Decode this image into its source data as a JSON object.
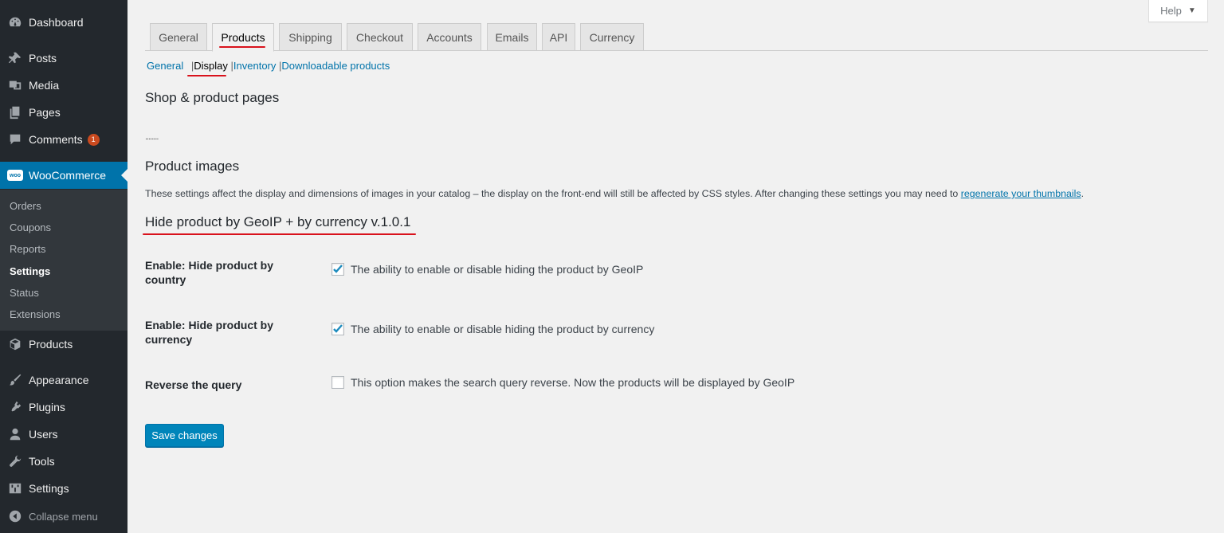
{
  "sidebar": {
    "dashboard": {
      "label": "Dashboard",
      "icon": "dashboard-icon"
    },
    "posts": {
      "label": "Posts",
      "icon": "pin-icon"
    },
    "media": {
      "label": "Media",
      "icon": "media-icon"
    },
    "pages": {
      "label": "Pages",
      "icon": "pages-icon"
    },
    "comments": {
      "label": "Comments",
      "icon": "comment-icon",
      "badge": "1"
    },
    "woocommerce": {
      "label": "WooCommerce",
      "icon": "woo-icon",
      "logo_text": "woo"
    },
    "submenu": {
      "orders": "Orders",
      "coupons": "Coupons",
      "reports": "Reports",
      "settings": "Settings",
      "status": "Status",
      "extensions": "Extensions"
    },
    "products": {
      "label": "Products",
      "icon": "box-icon"
    },
    "appearance": {
      "label": "Appearance",
      "icon": "brush-icon"
    },
    "plugins": {
      "label": "Plugins",
      "icon": "plug-icon"
    },
    "users": {
      "label": "Users",
      "icon": "user-icon"
    },
    "tools": {
      "label": "Tools",
      "icon": "wrench-icon"
    },
    "settings": {
      "label": "Settings",
      "icon": "sliders-icon"
    },
    "collapse": {
      "label": "Collapse menu",
      "icon": "collapse-icon"
    }
  },
  "help": {
    "label": "Help",
    "caret": "▼"
  },
  "tabs": [
    "General",
    "Products",
    "Shipping",
    "Checkout",
    "Accounts",
    "Emails",
    "API",
    "Currency"
  ],
  "subnav": {
    "general": "General",
    "sep1": "|",
    "display": "Display",
    "sep2": "|",
    "inventory": "Inventory",
    "sep3": "|",
    "downloadable": "Downloadable products"
  },
  "sections": {
    "shop_title": "Shop & product pages",
    "dots": "........",
    "images_title": "Product images",
    "images_desc": "These settings affect the display and dimensions of images in your catalog – the display on the front-end will still be affected by CSS styles. After changing these settings you may need to",
    "regenerate_link": "regenerate your thumbnails",
    "desc_end": ".",
    "plugin_title": "Hide product by GeoIP + by currency v.1.0.1"
  },
  "fields": {
    "country": {
      "label": "Enable: Hide product by country",
      "text": "The ability to enable or disable hiding the product by GeoIP",
      "checked": true
    },
    "currency": {
      "label": "Enable: Hide product by currency",
      "text": "The ability to enable or disable hiding the product by currency",
      "checked": true
    },
    "reverse": {
      "label": "Reverse the query",
      "text": "This option makes the search query reverse. Now the products will be displayed by GeoIP",
      "checked": false
    }
  },
  "save_button": "Save changes",
  "colors": {
    "accent": "#0073aa",
    "sidebar": "#23282d",
    "annotation": "#d9121c"
  }
}
